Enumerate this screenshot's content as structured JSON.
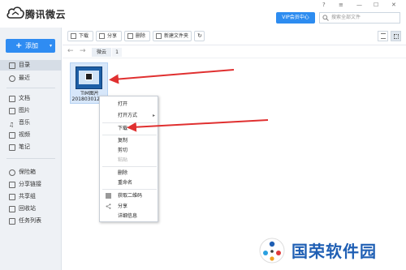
{
  "app": {
    "title": "腾讯微云",
    "vip_label": "VIP会员中心",
    "search_placeholder": "搜索全部文件",
    "win_controls": [
      "?",
      "≡",
      "—",
      "☐",
      "✕"
    ]
  },
  "sidebar": {
    "add_label": "添加",
    "items": [
      {
        "label": "目录",
        "icon": "folder-icon",
        "active": true
      },
      {
        "label": "最近",
        "icon": "clock-icon"
      },
      {
        "label": "文档",
        "icon": "doc-icon"
      },
      {
        "label": "图片",
        "icon": "image-icon"
      },
      {
        "label": "音乐",
        "icon": "music-icon"
      },
      {
        "label": "视频",
        "icon": "video-icon"
      },
      {
        "label": "笔记",
        "icon": "note-icon"
      },
      {
        "label": "保险箱",
        "icon": "safe-icon"
      },
      {
        "label": "分享链接",
        "icon": "share-link-icon"
      },
      {
        "label": "共享组",
        "icon": "group-icon"
      },
      {
        "label": "回收站",
        "icon": "trash-icon"
      },
      {
        "label": "任务列表",
        "icon": "tasklist-icon"
      }
    ]
  },
  "toolbar": {
    "buttons": [
      {
        "label": "下载",
        "icon": "download-icon"
      },
      {
        "label": "分享",
        "icon": "share-icon"
      },
      {
        "label": "删除",
        "icon": "delete-icon"
      },
      {
        "label": "新建文件夹",
        "icon": "new-folder-icon"
      }
    ],
    "refresh_icon": "refresh-icon"
  },
  "breadcrumb": {
    "back": "←",
    "forward": "→",
    "items": [
      "微云"
    ],
    "count": "1"
  },
  "file": {
    "name_line1": "TIM图片",
    "name_line2": "2018030120..."
  },
  "context_menu": {
    "items": [
      {
        "label": "打开"
      },
      {
        "label": "打开方式",
        "submenu": true
      },
      {
        "label": "下载"
      },
      {
        "label": "复制"
      },
      {
        "label": "剪切"
      },
      {
        "label": "粘贴",
        "disabled": true
      },
      {
        "label": "删除"
      },
      {
        "label": "重命名"
      },
      {
        "label": "获取二维码",
        "icon": "qrcode-icon"
      },
      {
        "label": "分享",
        "icon": "share-icon"
      },
      {
        "label": "详细信息"
      }
    ]
  },
  "watermark": {
    "text": "国荣软件园"
  },
  "colors": {
    "accent": "#2f8cf2",
    "sidebar_bg": "#eef1f5",
    "arrow_red": "#e03030",
    "watermark_blue": "#1f5fb4"
  }
}
